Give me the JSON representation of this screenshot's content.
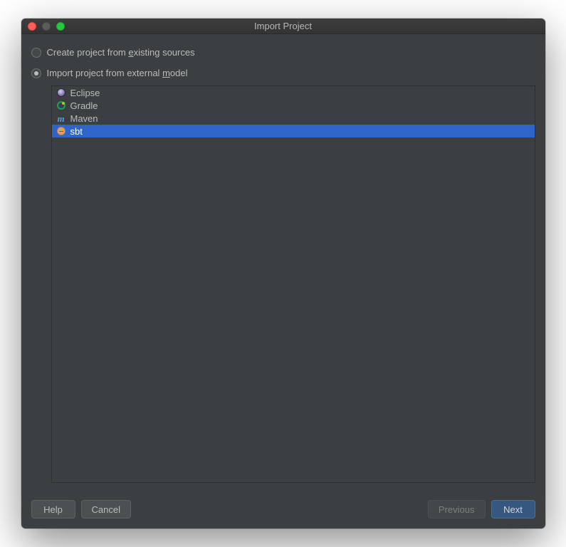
{
  "window": {
    "title": "Import Project"
  },
  "options": {
    "create_label_pre": "Create project from ",
    "create_label_mn": "e",
    "create_label_post": "xisting sources",
    "import_label_pre": "Import project from external ",
    "import_label_mn": "m",
    "import_label_post": "odel",
    "selected": "import"
  },
  "models": {
    "items": [
      {
        "name": "Eclipse",
        "icon": "eclipse",
        "selected": false
      },
      {
        "name": "Gradle",
        "icon": "gradle",
        "selected": false
      },
      {
        "name": "Maven",
        "icon": "maven",
        "selected": false
      },
      {
        "name": "sbt",
        "icon": "sbt",
        "selected": true
      }
    ]
  },
  "buttons": {
    "help": "Help",
    "cancel": "Cancel",
    "previous": "Previous",
    "next": "Next"
  }
}
